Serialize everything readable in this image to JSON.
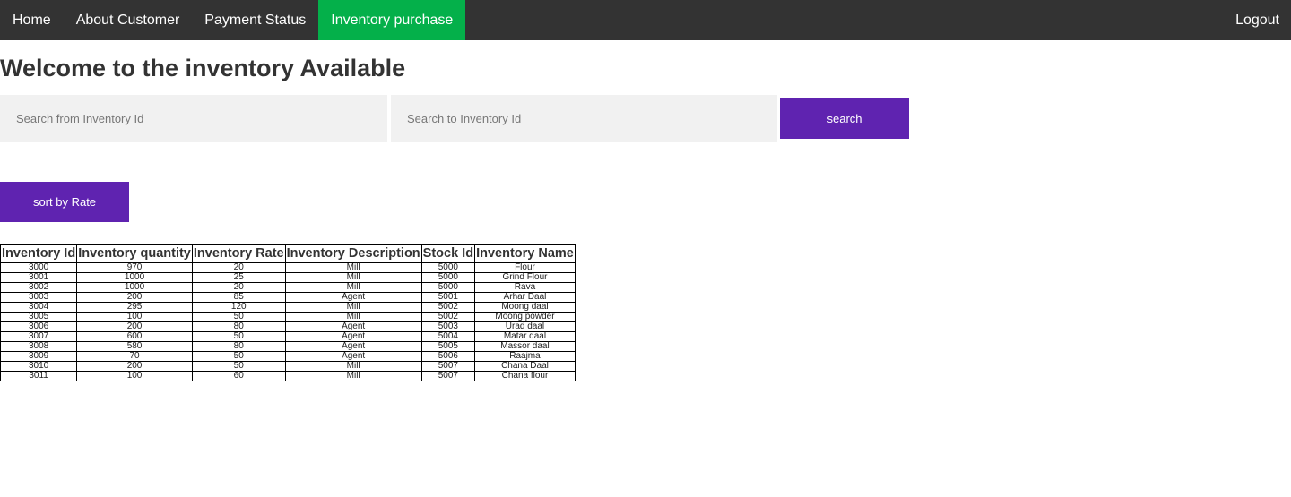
{
  "nav": {
    "items": [
      {
        "label": "Home",
        "active": false
      },
      {
        "label": "About Customer",
        "active": false
      },
      {
        "label": "Payment Status",
        "active": false
      },
      {
        "label": "Inventory purchase",
        "active": true
      }
    ],
    "logout_label": "Logout"
  },
  "page_title": "Welcome to the inventory Available",
  "search": {
    "from_placeholder": "Search from Inventory Id",
    "to_placeholder": "Search to Inventory Id",
    "button_label": "search"
  },
  "sort_button_label": "sort by Rate",
  "colors": {
    "nav_bg": "#333333",
    "active_tab": "#04b04a",
    "button_purple": "#5f23b0",
    "input_bg": "#f1f1f1"
  },
  "table": {
    "headers": [
      "Inventory Id",
      "Inventory quantity",
      "Inventory Rate",
      "Inventory Description",
      "Stock Id",
      "Inventory Name"
    ],
    "rows": [
      [
        "3000",
        "970",
        "20",
        "Mill",
        "5000",
        "Flour"
      ],
      [
        "3001",
        "1000",
        "25",
        "Mill",
        "5000",
        "Grind Flour"
      ],
      [
        "3002",
        "1000",
        "20",
        "Mill",
        "5000",
        "Rava"
      ],
      [
        "3003",
        "200",
        "85",
        "Agent",
        "5001",
        "Arhar Daal"
      ],
      [
        "3004",
        "295",
        "120",
        "Mill",
        "5002",
        "Moong daal"
      ],
      [
        "3005",
        "100",
        "50",
        "Mill",
        "5002",
        "Moong powder"
      ],
      [
        "3006",
        "200",
        "80",
        "Agent",
        "5003",
        "Urad daal"
      ],
      [
        "3007",
        "600",
        "50",
        "Agent",
        "5004",
        "Matar daal"
      ],
      [
        "3008",
        "580",
        "80",
        "Agent",
        "5005",
        "Massor daal"
      ],
      [
        "3009",
        "70",
        "50",
        "Agent",
        "5006",
        "Raajma"
      ],
      [
        "3010",
        "200",
        "50",
        "Mill",
        "5007",
        "Chana Daal"
      ],
      [
        "3011",
        "100",
        "60",
        "Mill",
        "5007",
        "Chana flour"
      ]
    ]
  }
}
